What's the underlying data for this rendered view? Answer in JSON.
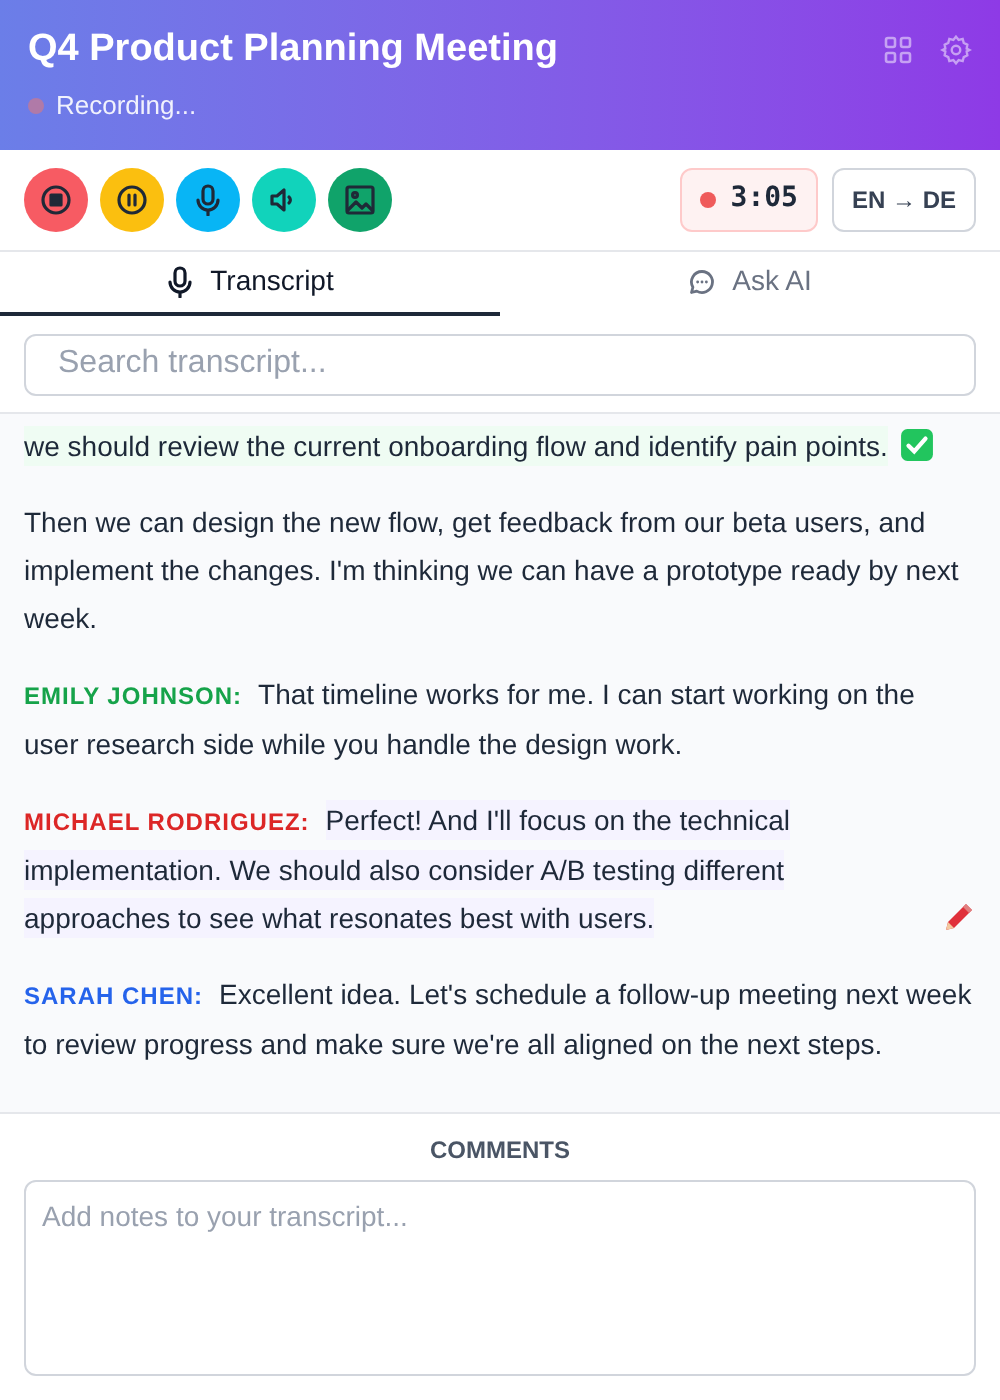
{
  "header": {
    "title": "Q4 Product Planning Meeting",
    "status": "Recording..."
  },
  "controls": [
    {
      "kind": "stop",
      "color": "#f75b63"
    },
    {
      "kind": "pause",
      "color": "#fbbf0f"
    },
    {
      "kind": "mic",
      "color": "#08b5f5"
    },
    {
      "kind": "speaker",
      "color": "#11d3bb"
    },
    {
      "kind": "image",
      "color": "#10a36a"
    }
  ],
  "timer": "3:05",
  "language": "EN → DE",
  "tabs": [
    {
      "label": "Transcript",
      "kind": "mic",
      "selected": true
    },
    {
      "label": "Ask AI",
      "kind": "chat",
      "selected": false
    }
  ],
  "search": {
    "placeholder": "Search transcript..."
  },
  "transcript": [
    {
      "text": "we should review the current onboarding flow and identify pain points.",
      "kind": "approved"
    },
    {
      "kind": "plain",
      "text": " Then we can design the new flow, get feedback from our beta users, and implement the changes. I'm thinking we can have a prototype ready by next week."
    },
    {
      "kind": "plain",
      "speaker": "EMILY JOHNSON:",
      "color": "#16a34a",
      "text": "That timeline works for me. I can start working on the user research side while you handle the design work."
    },
    {
      "speaker": "MICHAEL RODRIGUEZ:",
      "color": "#dc2626",
      "text": "Perfect! And I'll focus on the technical implementation. We should also consider A/B testing different approaches to see what resonates best with users.",
      "kind": "edited"
    },
    {
      "kind": "plain",
      "speaker": "SARAH CHEN:",
      "color": "#2563eb",
      "text": "Excellent idea. Let's schedule a follow-up meeting next week to review progress and make sure we're all aligned on the next steps."
    }
  ],
  "comments": {
    "title": "COMMENTS",
    "placeholder": "Add notes to your transcript..."
  }
}
